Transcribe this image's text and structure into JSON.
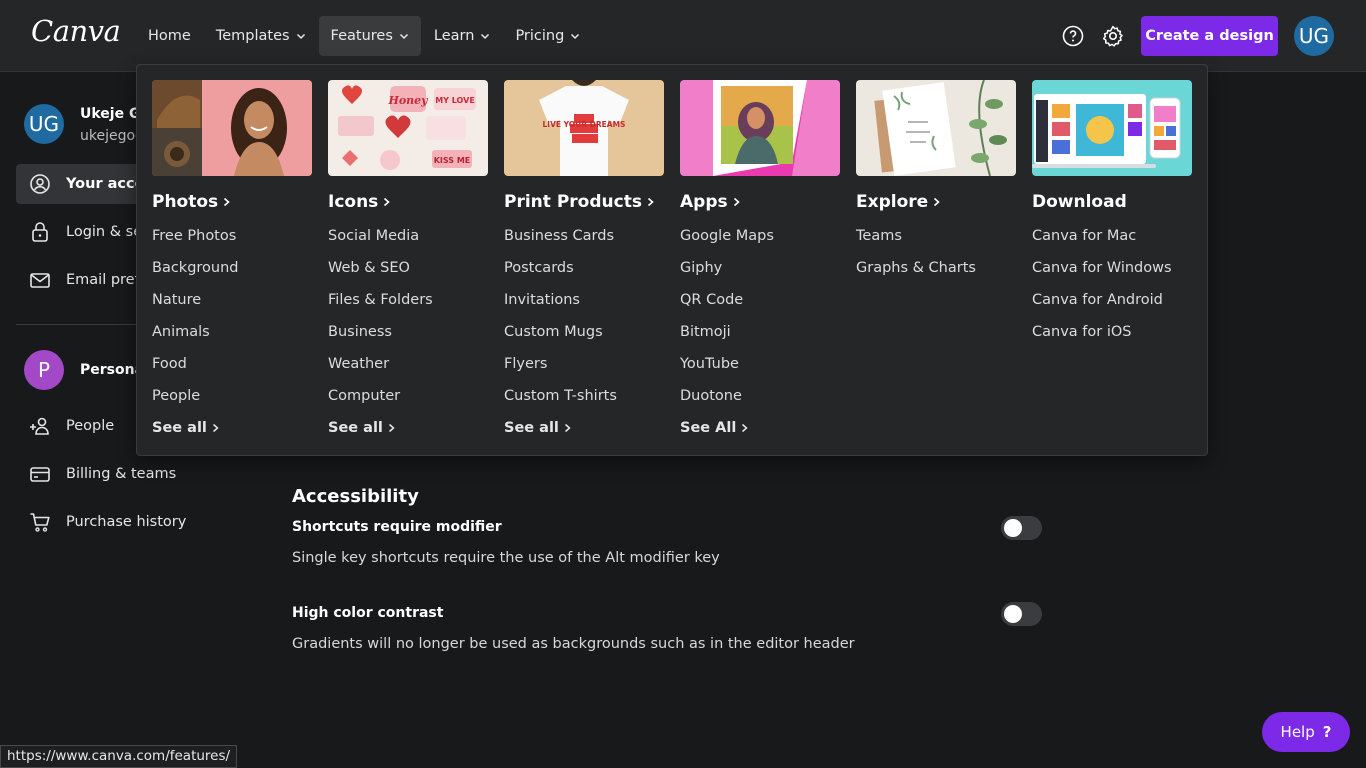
{
  "brand": {
    "logo_text": "Canva",
    "accent": "#7d2ae8"
  },
  "nav": {
    "items": [
      {
        "label": "Home",
        "has_chevron": false
      },
      {
        "label": "Templates",
        "has_chevron": true
      },
      {
        "label": "Features",
        "has_chevron": true
      },
      {
        "label": "Learn",
        "has_chevron": true
      },
      {
        "label": "Pricing",
        "has_chevron": true
      }
    ],
    "active": "Features",
    "create_label": "Create a design",
    "avatar_initials": "UG"
  },
  "sidebar": {
    "user_initials": "UG",
    "user_name": "Ukeje Go",
    "user_email": "ukejegoo",
    "items": [
      {
        "label": "Your accou",
        "icon": "person-circle-icon"
      },
      {
        "label": "Login & sec",
        "icon": "lock-icon"
      },
      {
        "label": "Email prefe",
        "icon": "envelope-icon"
      }
    ],
    "team_initial": "P",
    "team_name": "Persona",
    "team_items": [
      {
        "label": "People",
        "icon": "add-people-icon"
      },
      {
        "label": "Billing & teams",
        "icon": "credit-card-icon"
      },
      {
        "label": "Purchase history",
        "icon": "cart-icon"
      }
    ]
  },
  "dropdown": {
    "columns": [
      {
        "heading": "Photos",
        "heading_arrow": true,
        "links": [
          "Free Photos",
          "Background",
          "Nature",
          "Animals",
          "Food",
          "People"
        ],
        "see_all": "See all"
      },
      {
        "heading": "Icons",
        "heading_arrow": true,
        "links": [
          "Social Media",
          "Web & SEO",
          "Files & Folders",
          "Business",
          "Weather",
          "Computer"
        ],
        "see_all": "See all"
      },
      {
        "heading": "Print Products",
        "heading_arrow": true,
        "links": [
          "Business Cards",
          "Postcards",
          "Invitations",
          "Custom Mugs",
          "Flyers",
          "Custom T-shirts"
        ],
        "see_all": "See all"
      },
      {
        "heading": "Apps",
        "heading_arrow": true,
        "links": [
          "Google Maps",
          "Giphy",
          "QR Code",
          "Bitmoji",
          "YouTube",
          "Duotone"
        ],
        "see_all": "See All"
      },
      {
        "heading": "Explore",
        "heading_arrow": true,
        "links": [
          "Teams",
          "Graphs & Charts"
        ],
        "see_all": ""
      },
      {
        "heading": "Download",
        "heading_arrow": false,
        "links": [
          "Canva for Mac",
          "Canva for Windows",
          "Canva for Android",
          "Canva for iOS"
        ],
        "see_all": ""
      }
    ],
    "icons_thumb_text": {
      "honey": "Honey",
      "my_love": "MY LOVE",
      "kiss_me": "KISS ME"
    },
    "tshirt_text": "LIVE YOUR DREAMS"
  },
  "accessibility": {
    "title": "Accessibility",
    "settings": [
      {
        "title": "Shortcuts require modifier",
        "desc": "Single key shortcuts require the use of the Alt modifier key",
        "enabled": false
      },
      {
        "title": "High color contrast",
        "desc": "Gradients will no longer be used as backgrounds such as in the editor header",
        "enabled": false
      }
    ]
  },
  "help_button": {
    "label": "Help",
    "symbol": "?"
  },
  "status_url": "https://www.canva.com/features/"
}
